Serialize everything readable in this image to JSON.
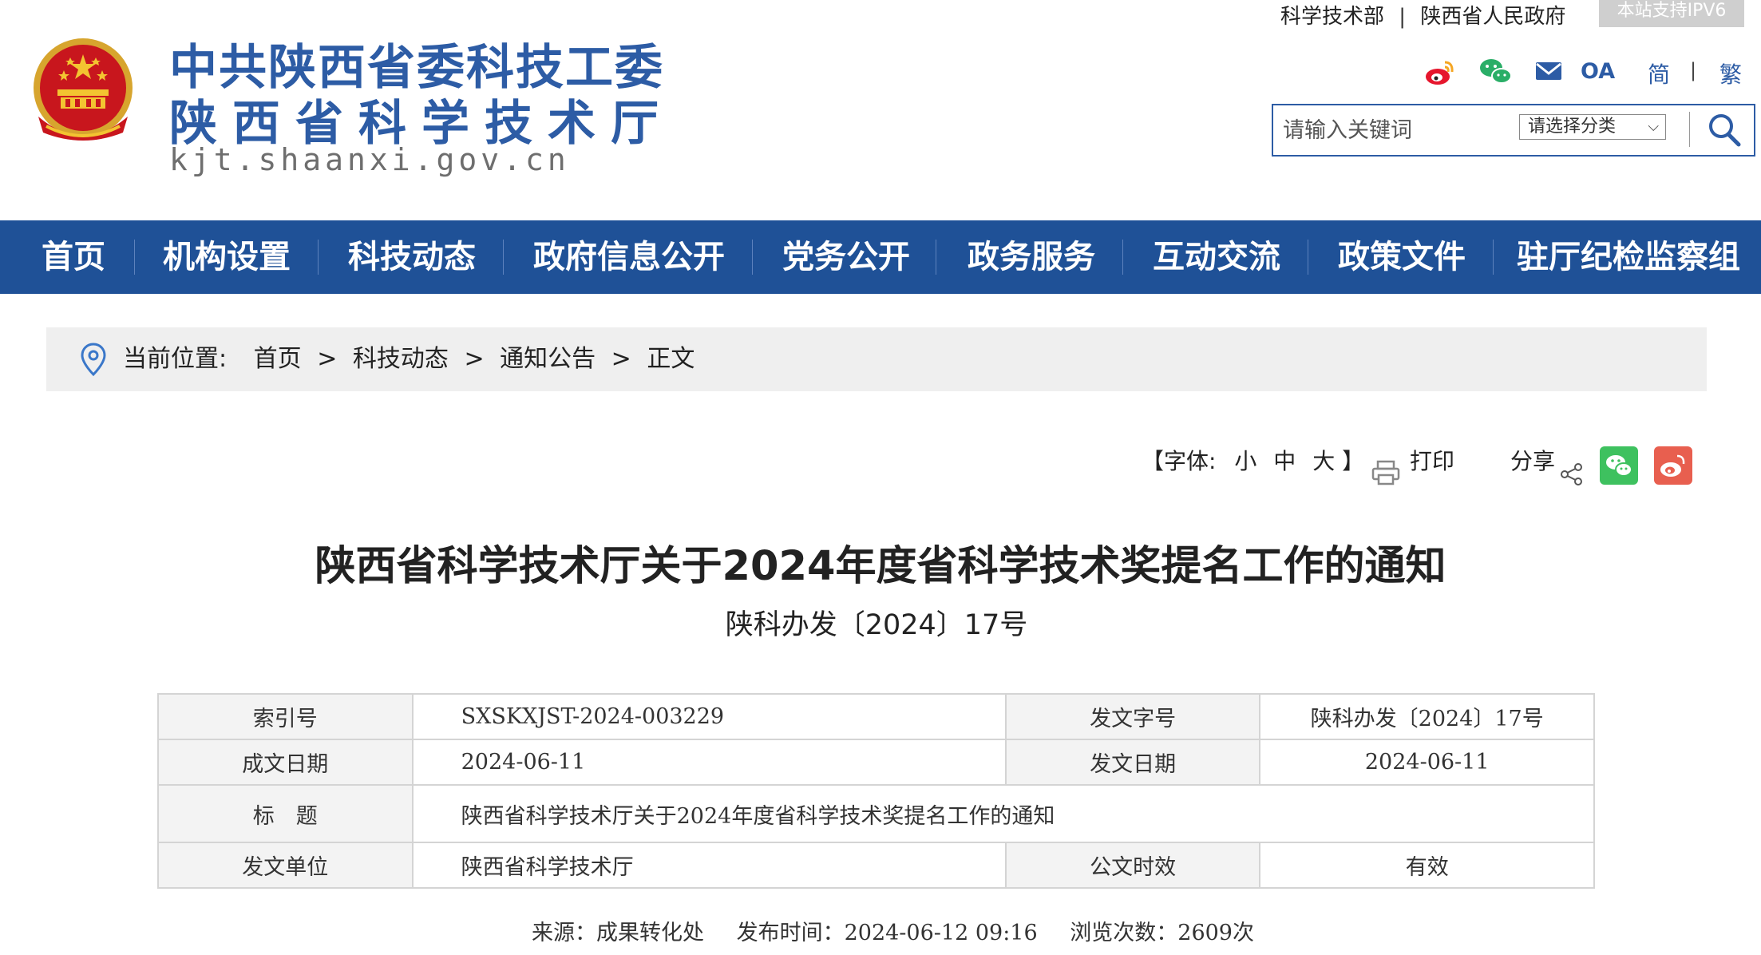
{
  "header": {
    "site_name_line1": "中共陕西省委科技工委",
    "site_name_line2": "陕西省科学技术厅",
    "domain": "kjt.shaanxi.gov.cn",
    "top_links": [
      "科学技术部",
      "陕西省人民政府"
    ],
    "top_link_separator": "|",
    "ipv6_badge": "本站支持IPV6",
    "icons": [
      "weibo-icon",
      "wechat-icon",
      "mail-icon",
      "oa-icon"
    ],
    "oa_label": "OA",
    "lang_simplified": "简",
    "lang_separator": "|",
    "lang_traditional": "繁",
    "search": {
      "placeholder": "请输入关键词",
      "category_label": "请选择分类"
    },
    "brand_color": "#2d5ca5"
  },
  "nav": {
    "background_color": "#1f5197",
    "items": [
      "首页",
      "机构设置",
      "科技动态",
      "政府信息公开",
      "党务公开",
      "政务服务",
      "互动交流",
      "政策文件",
      "驻厅纪检监察组"
    ]
  },
  "breadcrumb": {
    "prefix": "当前位置:",
    "items": [
      "首页",
      "科技动态",
      "通知公告",
      "正文"
    ],
    "separator": ">"
  },
  "tools": {
    "font_prefix": "【字体:",
    "font_small": "小",
    "font_medium": "中",
    "font_large": "大",
    "font_suffix": "】",
    "print_label": "打印",
    "share_label": "分享"
  },
  "article": {
    "title": "陕西省科学技术厅关于2024年度省科学技术奖提名工作的通知",
    "doc_number": "陕科办发〔2024〕17号"
  },
  "meta": {
    "index_label": "索引号",
    "index_value": "SXSKXJST-2024-003229",
    "docno_label": "发文字号",
    "docno_value": "陕科办发〔2024〕17号",
    "created_label": "成文日期",
    "created_value": "2024-06-11",
    "issued_label": "发文日期",
    "issued_value": "2024-06-11",
    "title_label": "标　题",
    "title_value": "陕西省科学技术厅关于2024年度省科学技术奖提名工作的通知",
    "issuer_label": "发文单位",
    "issuer_value": "陕西省科学技术厅",
    "validity_label": "公文时效",
    "validity_value": "有效"
  },
  "footer_meta": {
    "source": "来源：成果转化处",
    "publish_time": "发布时间：2024-06-12 09:16",
    "views": "浏览次数：2609次"
  }
}
